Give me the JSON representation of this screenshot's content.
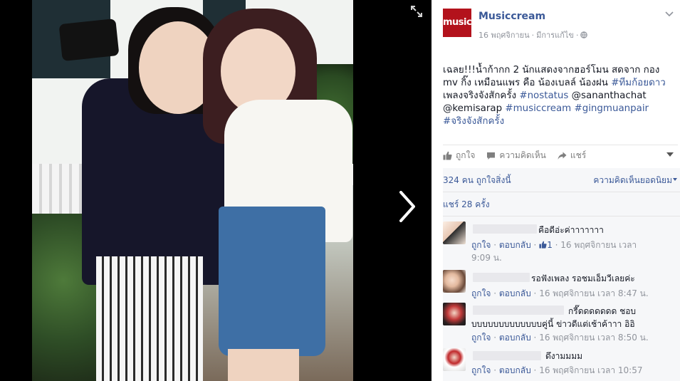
{
  "page": {
    "name": "Musiccream",
    "avatar_text": "music"
  },
  "post": {
    "date": "16 พฤศจิกายน",
    "edited": "มีการแก้ไข",
    "text_main": "เฉลย!!!น้ำก้ากก 2 นักแสดงจากฮอร์โมน สดจาก กอง mv กิ๊ง เหมือนแพร คือ น้องเบลล์ น้องฝน",
    "tag1": "#ทีมก้อยดาว",
    "text_mid": " เพลงจริงจังสักครั้ง ",
    "tag2": "#nostatus",
    "mention1": "@sananthachat",
    "mention2": "@kemisarap",
    "tag3": "#musiccream",
    "tag4": "#gingmuanpair",
    "tag5": "#จริงจังสักครั้ง"
  },
  "actions": {
    "like": "ถูกใจ",
    "comment": "ความคิดเห็น",
    "share": "แชร์"
  },
  "stats": {
    "likes": "324 คน ถูกใจสิ่งนี้",
    "comment_order": "ความคิดเห็นยอดนิยม",
    "shares": "แชร์ 28 ครั้ง"
  },
  "comments": [
    {
      "text": "คือดีอ่ะค่าาาาาาา",
      "like_label": "ถูกใจ",
      "reply_label": "ตอบกลับ",
      "like_count": "1",
      "time": "16 พฤศจิกายน เวลา",
      "time2": "9:09 น."
    },
    {
      "text": "รอฟังเพลง รอชมเอ็มวีเลยค่ะ",
      "like_label": "ถูกใจ",
      "reply_label": "ตอบกลับ",
      "time": "16 พฤศจิกายน เวลา 8:47 น."
    },
    {
      "text": "กรี๊ดดดดดดด ชอบ",
      "text2": "บบบบบบบบบบบบบคู่นี้ ข่าวดีแต่เช้าค้าาา อิอิ",
      "like_label": "ถูกใจ",
      "reply_label": "ตอบกลับ",
      "time": "16 พฤศจิกายน เวลา 8:50 น."
    },
    {
      "text": "ดึงามมมม",
      "like_label": "ถูกใจ",
      "reply_label": "ตอบกลับ",
      "time": "16 พฤศจิกายน เวลา 10:57"
    }
  ],
  "colors": {
    "link": "#3b5998",
    "brand_red": "#b3121c",
    "panel_bg": "#f6f7f9"
  },
  "icons": [
    "expand-icon",
    "chevron-right-icon",
    "chevron-down-icon",
    "globe-icon",
    "thumbs-up-icon",
    "comment-icon",
    "share-icon",
    "caret-down-icon"
  ]
}
